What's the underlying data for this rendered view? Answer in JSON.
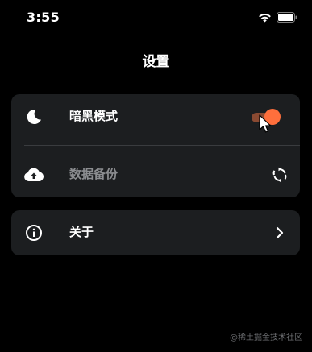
{
  "status_bar": {
    "time": "3:55",
    "icons": [
      "wifi-icon",
      "battery-icon"
    ]
  },
  "nav": {
    "title": "设置"
  },
  "settings": {
    "dark_mode": {
      "icon": "moon-icon",
      "label": "暗黑模式",
      "enabled": true,
      "toggle_color": "#ff6f3c"
    },
    "backup": {
      "icon": "cloud-upload-icon",
      "label": "数据备份",
      "trailing_icon": "sync-icon"
    },
    "about": {
      "icon": "info-icon",
      "label": "关于",
      "trailing_icon": "chevron-right-icon"
    }
  },
  "watermark": "@稀土掘金技术社区",
  "colors": {
    "background": "#000000",
    "card": "#1c1e20",
    "accent": "#ff6f3c"
  }
}
